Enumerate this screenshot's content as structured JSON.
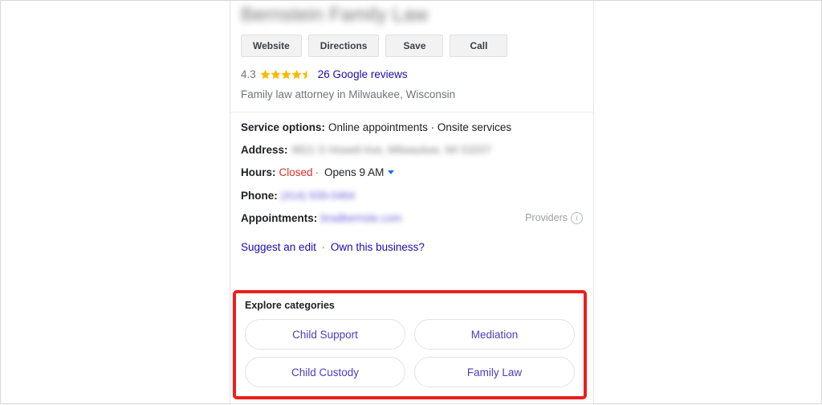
{
  "panel": {
    "business_name": "Bernstein Family Law",
    "business_name_redacted": true,
    "actions": [
      {
        "label": "Website",
        "icon": "globe-icon"
      },
      {
        "label": "Directions",
        "icon": "directions-icon"
      },
      {
        "label": "Save",
        "icon": "bookmark-icon"
      },
      {
        "label": "Call",
        "icon": "phone-icon"
      }
    ],
    "rating": {
      "value": "4.3",
      "stars_filled": 4,
      "stars_half": 1,
      "stars_total": 5,
      "star_color": "#fabb05",
      "reviews_label": "26 Google reviews"
    },
    "category_line": "Family law attorney in Milwaukee, Wisconsin",
    "details": [
      {
        "label": "Service options:",
        "value": "Online appointments · Onsite services",
        "redacted": false,
        "style": "text"
      },
      {
        "label": "Address:",
        "value": "3821 S Howell Ave, Milwaukee, WI 53207",
        "redacted": true,
        "style": "blur-gray"
      },
      {
        "label": "Hours:",
        "status": "Closed",
        "status_color": "#d93025",
        "value": "Opens 9 AM",
        "has_caret": true,
        "redacted": false,
        "style": "hours"
      },
      {
        "label": "Phone:",
        "value": "(414) 939-0464",
        "redacted": true,
        "style": "blur-link"
      },
      {
        "label": "Appointments:",
        "value": "bradbernste.com",
        "redacted": true,
        "style": "blur-link",
        "trailing": {
          "label": "Providers",
          "icon": "info-icon"
        }
      }
    ],
    "edit_links": {
      "suggest_edit": "Suggest an edit",
      "separator": "·",
      "own_business": "Own this business?"
    },
    "explore": {
      "heading": "Explore categories",
      "highlight_color": "#ee1d1d",
      "chips": [
        [
          "Child Support",
          "Mediation"
        ],
        [
          "Child Custody",
          "Family Law"
        ]
      ]
    }
  }
}
